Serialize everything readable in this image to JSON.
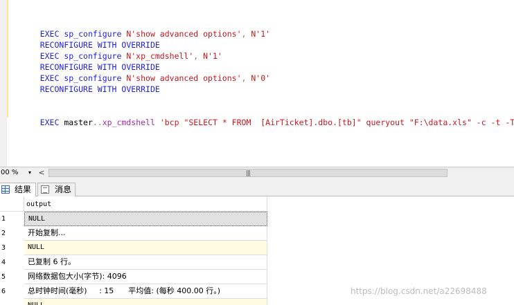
{
  "editor": {
    "lines": [
      {
        "t1": "EXEC sp_configure ",
        "t2": "N'show advanced options'",
        "t3": ", ",
        "t4": "N'1'"
      },
      {
        "t1": "RECONFIGURE WITH OVERRIDE"
      },
      {
        "t1": "EXEC sp_configure ",
        "t2": "N'xp_cmdshell'",
        "t3": ", ",
        "t4": "N'1'"
      },
      {
        "t1": "RECONFIGURE WITH OVERRIDE"
      },
      {
        "t1": "EXEC sp_configure ",
        "t2": "N'show advanced options'",
        "t3": ", ",
        "t4": "N'0'"
      },
      {
        "t1": "RECONFIGURE WITH OVERRIDE"
      }
    ],
    "bcp_line": {
      "kw": "EXEC ",
      "obj": "master",
      "dots": "..",
      "proc": "xp_cmdshell",
      "str": " 'bcp \"SELECT * FROM  [AirTicket].dbo.[tb]\" queryout \"F:\\data.xls\" -c -t -T '"
    }
  },
  "zoom": {
    "value": "00 %",
    "arrow": "▾"
  },
  "hscroll": {
    "left_arrow": "<",
    "grip": "|||"
  },
  "tabs": {
    "results": "结果",
    "messages": "消息"
  },
  "grid": {
    "column": "output",
    "rows": [
      {
        "num": "1",
        "value": "NULL",
        "null": true,
        "selected": true
      },
      {
        "num": "2",
        "value": "开始复制...",
        "null": false
      },
      {
        "num": "3",
        "value": "NULL",
        "null": true
      },
      {
        "num": "4",
        "value": "已复制 6 行。",
        "null": false
      },
      {
        "num": "5",
        "value": "网络数据包大小(字节): 4096",
        "null": false
      },
      {
        "num": "6",
        "value": "总时钟时间(毫秒)     : 15      平均值: (每秒 400.00 行。)",
        "null": false
      },
      {
        "num": "",
        "value": "NULL",
        "null": true
      }
    ]
  },
  "watermark": "https://blog.csdn.net/a22698488"
}
